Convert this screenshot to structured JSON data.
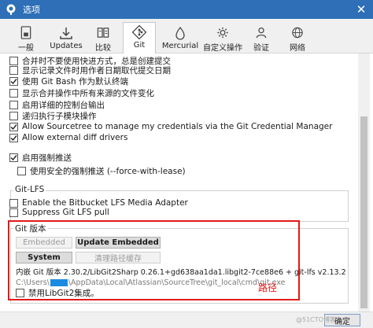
{
  "window": {
    "title": "选项"
  },
  "tabs": [
    {
      "label": "一般",
      "icon": "general-icon"
    },
    {
      "label": "Updates",
      "icon": "updates-icon"
    },
    {
      "label": "比较",
      "icon": "compare-icon"
    },
    {
      "label": "Git",
      "icon": "git-icon",
      "active": true
    },
    {
      "label": "Mercurial",
      "icon": "mercurial-icon"
    },
    {
      "label": "自定义操作",
      "icon": "custom-actions-icon"
    },
    {
      "label": "验证",
      "icon": "auth-icon"
    },
    {
      "label": "网络",
      "icon": "network-icon"
    }
  ],
  "options": [
    {
      "label": "合并时不要使用快进方式，总是创建提交",
      "checked": false
    },
    {
      "label": "显示记录文件时用作者日期取代提交日期",
      "checked": false
    },
    {
      "label": "使用 Git Bash 作为默认终端",
      "checked": true
    },
    {
      "label": "显示合并操作中所有来源的文件变化",
      "checked": false
    },
    {
      "label": "启用详细的控制台输出",
      "checked": false
    },
    {
      "label": "递归执行子模块操作",
      "checked": false
    },
    {
      "label": "Allow Sourcetree to manage my credentials via the Git Credential Manager",
      "checked": true
    },
    {
      "label": "Allow external diff drivers",
      "checked": true
    }
  ],
  "force_push": {
    "enable_label": "启用强制推送",
    "enable_checked": true,
    "safe_label": "使用安全的强制推送 (--force-with-lease)",
    "safe_checked": false
  },
  "git_lfs": {
    "title": "Git-LFS",
    "options": [
      {
        "label": "Enable the Bitbucket LFS Media Adapter",
        "checked": false
      },
      {
        "label": "Suppress Git LFS pull",
        "checked": false
      }
    ]
  },
  "git_version": {
    "title": "Git 版本",
    "embedded_label": "Embedded",
    "update_embedded_label": "Update Embedded",
    "system_label": "System",
    "clear_path_cache_label": "清理路径缓存",
    "version_text": "内嵌 Git 版本 2.30.2/LibGit2Sharp 0.26.1+gd638aa1da1.libgit2-7ce88e6 + git-lfs v2.13.2",
    "path_prefix": "C:\\Users\\",
    "path_suffix": "\\AppData\\Local\\Atlassian\\SourceTree\\git_local\\cmd\\git.exe",
    "disable_libgit2_label": "禁用LibGit2集成。",
    "disable_libgit2_checked": false
  },
  "annotation": {
    "text": "路径",
    "color": "#e21a1a"
  },
  "footer": {
    "ok_label": "确定"
  },
  "watermark": "@51CTO博客",
  "colors": {
    "titlebar": "#2e6fb7",
    "highlight_box": "#e21a1a",
    "mask": "#1a8be0"
  }
}
